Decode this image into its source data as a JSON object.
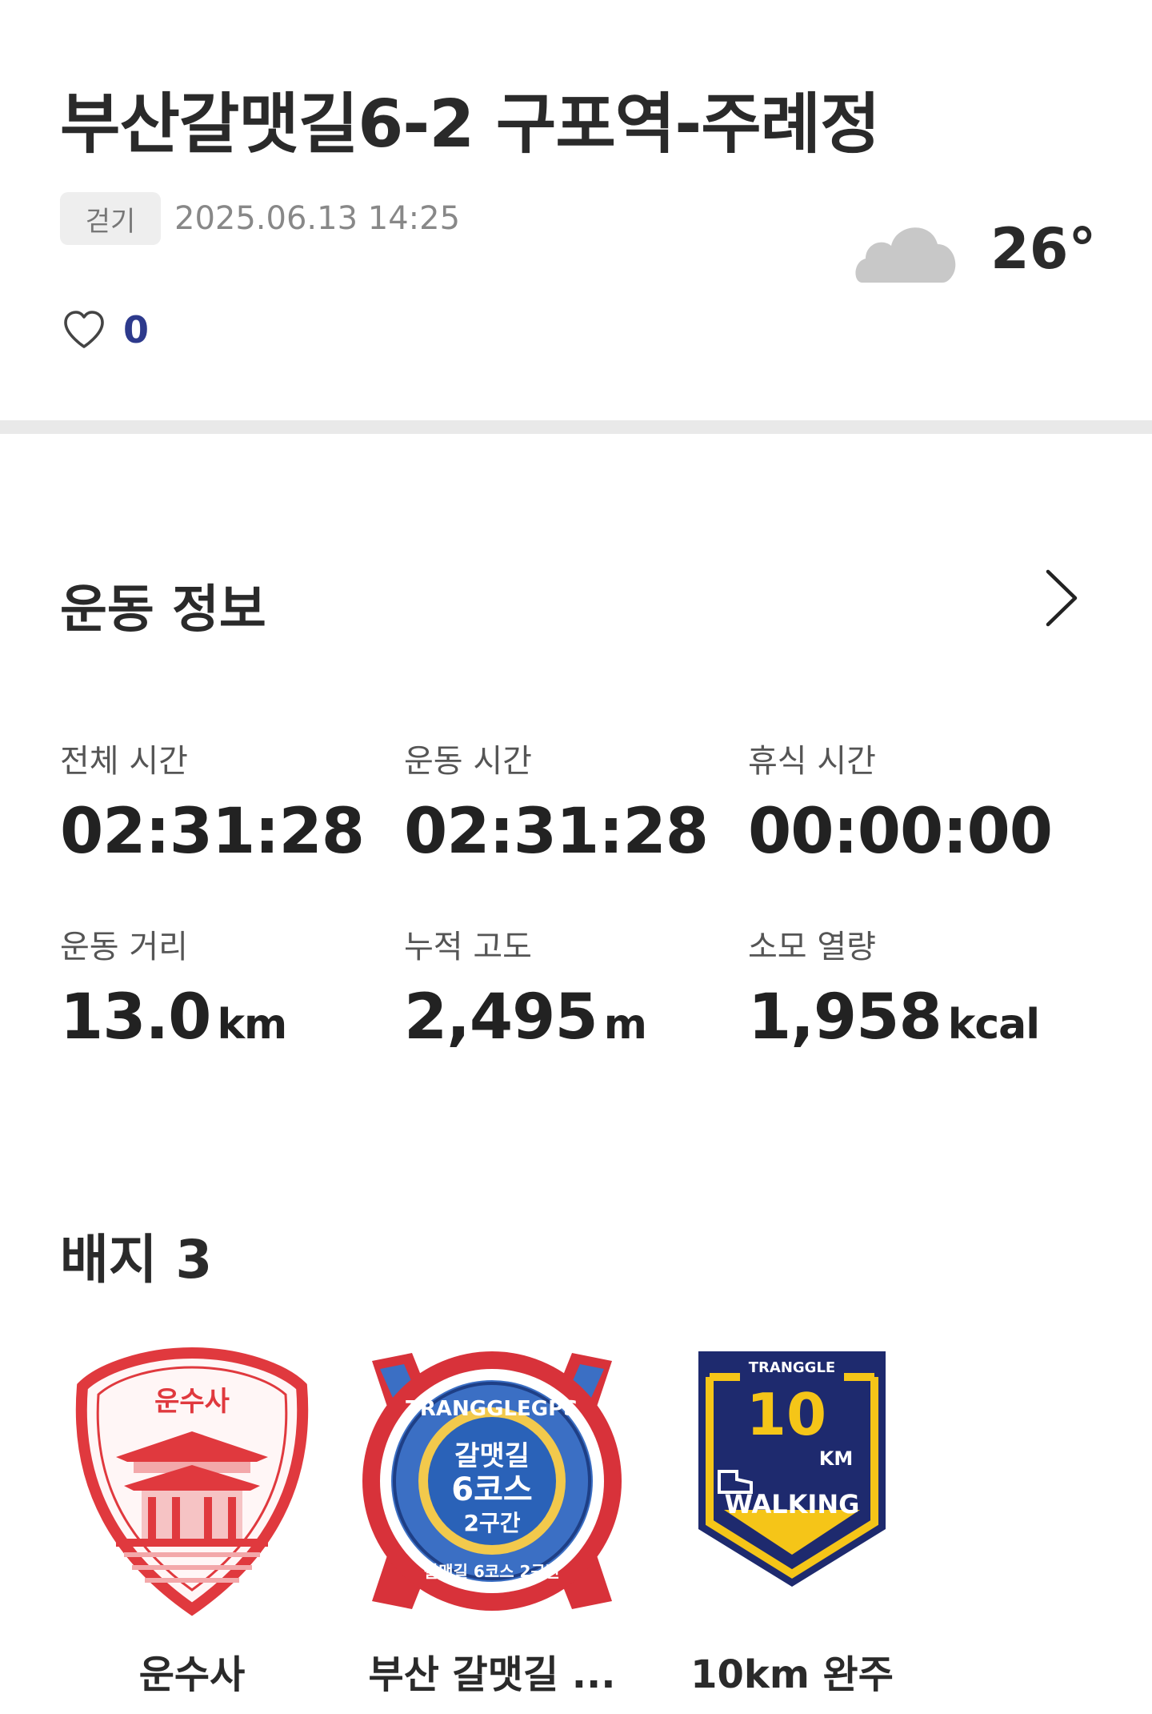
{
  "header": {
    "title": "부산갈맷길6-2 구포역-주례정",
    "activity_tag": "걷기",
    "datetime": "2025.06.13 14:25",
    "weather_icon": "cloud-icon",
    "temperature": "26°",
    "like_count": "0"
  },
  "workout": {
    "section_title": "운동 정보",
    "stats": [
      {
        "label": "전체 시간",
        "value": "02:31:28",
        "unit": ""
      },
      {
        "label": "운동 시간",
        "value": "02:31:28",
        "unit": ""
      },
      {
        "label": "휴식 시간",
        "value": "00:00:00",
        "unit": ""
      },
      {
        "label": "운동 거리",
        "value": "13.0",
        "unit": "km"
      },
      {
        "label": "누적 고도",
        "value": "2,495",
        "unit": "m"
      },
      {
        "label": "소모 열량",
        "value": "1,958",
        "unit": "kcal"
      }
    ]
  },
  "badges": {
    "section_title": "배지 3",
    "items": [
      {
        "label": "운수사",
        "badge_text": "운수사",
        "colors": {
          "primary": "#e0393e"
        }
      },
      {
        "label": "부산 갈맷길 ...",
        "badge_ring_text": "TRANGGLEGPS",
        "badge_line1": "갈맷길",
        "badge_line2": "6코스",
        "badge_line3": "2구간",
        "badge_bottom": "갈맷길 6코스 2구간",
        "colors": {
          "primary": "#2a62b8",
          "accent": "#f2c94c",
          "ring": "#d8323a"
        }
      },
      {
        "label": "10km 완주",
        "badge_brand": "TRANGGLE",
        "badge_number": "10",
        "badge_unit": "KM",
        "badge_word": "WALKING",
        "colors": {
          "primary": "#1e2a6e",
          "accent": "#f5c518"
        }
      }
    ]
  },
  "colors": {
    "like_count": "#2d3a8c",
    "divider": "#e9e9e9",
    "tag_bg": "#eeeeee"
  }
}
